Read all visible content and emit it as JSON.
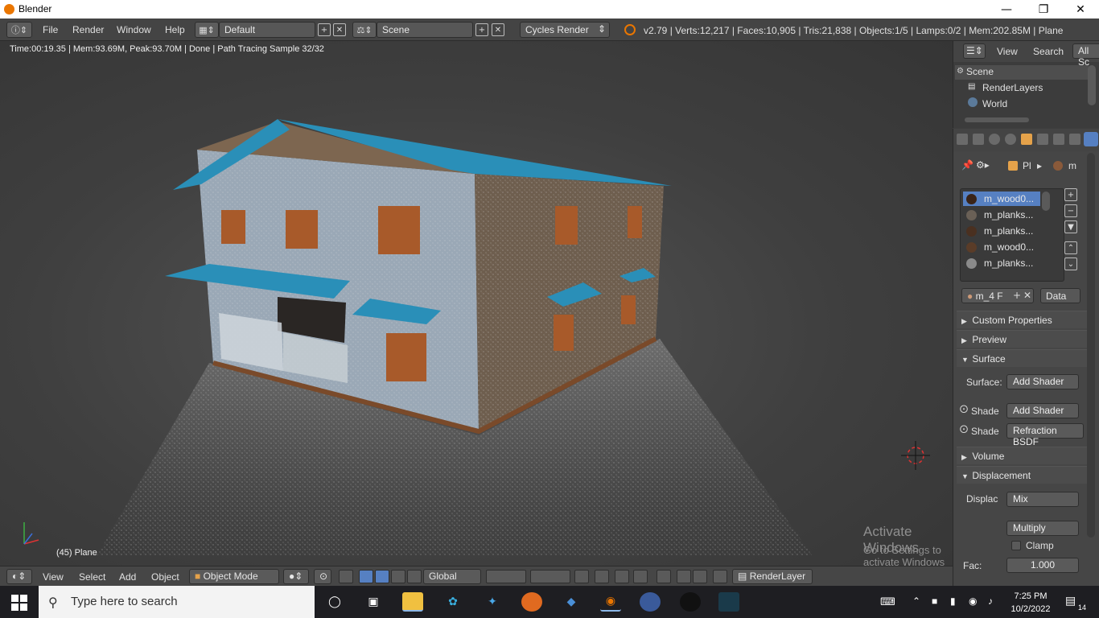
{
  "window": {
    "title": "Blender"
  },
  "info_header": {
    "menus": [
      "File",
      "Render",
      "Window",
      "Help"
    ],
    "screen_layout": "Default",
    "scene": "Scene",
    "render_engine": "Cycles Render",
    "stats": "v2.79 | Verts:12,217 | Faces:10,905 | Tris:21,838 | Objects:1/5 | Lamps:0/2 | Mem:202.85M | Plane"
  },
  "viewport": {
    "render_status": "Time:00:19.35 | Mem:93.69M, Peak:93.70M | Done | Path Tracing Sample 32/32",
    "object_label": "(45) Plane",
    "watermark_line1": "Activate Windows",
    "watermark_line2": "Go to Settings to activate Windows"
  },
  "view3d_header": {
    "menus": [
      "View",
      "Select",
      "Add",
      "Object"
    ],
    "mode": "Object Mode",
    "orientation": "Global",
    "render_layer": "RenderLayer"
  },
  "outliner": {
    "menus": [
      "View",
      "Search"
    ],
    "filter": "All Sc",
    "items": [
      "Scene",
      "RenderLayers",
      "World"
    ]
  },
  "properties": {
    "breadcrumb": [
      "Pl",
      "m"
    ],
    "material_slots": [
      "m_wood0...",
      "m_planks...",
      "m_planks...",
      "m_wood0...",
      "m_planks..."
    ],
    "slot_colors": [
      "#3a2418",
      "#6a6056",
      "#4a3020",
      "#5a3c28",
      "#8a8a8a"
    ],
    "material_name_field": "m_4",
    "material_field_f": "F",
    "link_dropdown": "Data",
    "panels": {
      "custom_properties": "Custom Properties",
      "preview": "Preview",
      "surface": "Surface",
      "volume": "Volume",
      "displacement": "Displacement"
    },
    "surface_label": "Surface:",
    "surface_value": "Add Shader",
    "shade_label_1": "Shade",
    "shade_value_1": "Add Shader",
    "shade_label_2": "Shade",
    "shade_value_2": "Refraction BSDF",
    "displacement_label": "Displac",
    "displacement_value": "Mix",
    "blend_mode": "Multiply",
    "clamp_label": "Clamp",
    "fac_label": "Fac:",
    "fac_value": "1.000"
  },
  "taskbar": {
    "search_placeholder": "Type here to search",
    "time": "7:25 PM",
    "date": "10/2/2022",
    "notification_count": "14"
  }
}
